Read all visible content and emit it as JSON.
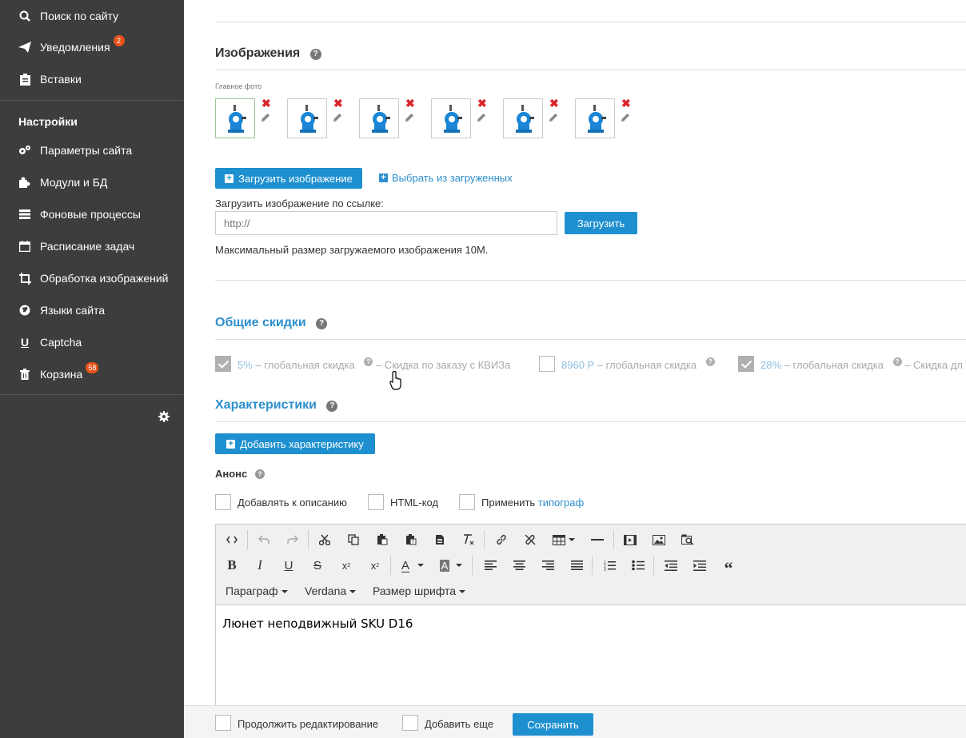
{
  "sidebar": {
    "items": [
      {
        "label": "Поиск по сайту",
        "icon": "search-icon"
      },
      {
        "label": "Уведомления",
        "icon": "paper-plane-icon",
        "badge": "2"
      },
      {
        "label": "Вставки",
        "icon": "clipboard-icon"
      },
      {
        "label": "Параметры сайта",
        "icon": "gears-icon"
      },
      {
        "label": "Модули и БД",
        "icon": "puzzle-icon"
      },
      {
        "label": "Фоновые процессы",
        "icon": "tasks-icon"
      },
      {
        "label": "Расписание задач",
        "icon": "calendar-icon"
      },
      {
        "label": "Обработка изображений",
        "icon": "crop-icon"
      },
      {
        "label": "Языки сайта",
        "icon": "globe-icon"
      },
      {
        "label": "Captcha",
        "icon": "underline-icon"
      },
      {
        "label": "Корзина",
        "icon": "trash-icon",
        "badge": "58"
      }
    ],
    "section_title": "Настройки"
  },
  "images": {
    "title": "Изображения",
    "main_photo_label": "Главное фото",
    "upload_button": "Загрузить изображение",
    "choose_link": "Выбрать из загруженных",
    "url_label": "Загрузить изображение по ссылке:",
    "url_placeholder": "http://",
    "url_button": "Загрузить",
    "max_size_note": "Максимальный размер загружаемого изображения 10M."
  },
  "discounts": {
    "title": "Общие скидки",
    "items": [
      {
        "value": "5%",
        "text": " – глобальная скидка",
        "note": " – Скидка по заказу с КВИЗа",
        "checked": true
      },
      {
        "value": "8960 Р",
        "text": " – глобальная скидка",
        "note": "",
        "checked": false
      },
      {
        "value": "28%",
        "text": " – глобальная скидка",
        "note": " – Скидка дл",
        "checked": true
      }
    ]
  },
  "characteristics": {
    "title": "Характеристики",
    "add_button": "Добавить характеристику"
  },
  "announce": {
    "title": "Анонс",
    "options": {
      "add_to_description": "Добавлять к описанию",
      "html_code": "HTML-код",
      "apply": "Применить",
      "typograph": "типограф"
    }
  },
  "editor": {
    "paragraph": "Параграф",
    "font": "Verdana",
    "font_size": "Размер шрифта",
    "content": "Люнет неподвижный SKU D16"
  },
  "footer": {
    "continue_editing": "Продолжить редактирование",
    "add_more": "Добавить еще",
    "save": "Сохранить"
  },
  "colors": {
    "accent": "#1e90d0",
    "sidebar_bg": "#3d3d3d",
    "badge": "#e9541b",
    "delete": "#d9262b"
  }
}
